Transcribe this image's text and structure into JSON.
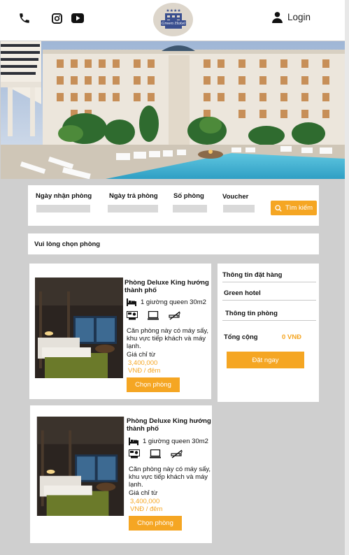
{
  "header": {
    "login_label": "Login",
    "logo_text": "Green Hotel",
    "icons": [
      "phone-icon",
      "instagram-icon",
      "youtube-icon",
      "user-icon"
    ]
  },
  "search": {
    "checkin_label": "Ngày nhận phòng",
    "checkout_label": "Ngày trả phòng",
    "rooms_label": "Số phòng",
    "voucher_label": "Voucher",
    "search_button": "Tìm kiếm"
  },
  "choose_room": "Vui lòng chọn phòng",
  "rooms": [
    {
      "title": "Phòng Deluxe King hướng thành phố",
      "bed": "1 giường queen 30m2",
      "description": "Căn phòng này có máy sấy, khu vực tiếp khách và máy lạnh.",
      "price_label": "Giá chỉ từ",
      "price": "3,400,000",
      "price_unit": "VNĐ / đêm",
      "button": "Chọn phòng"
    },
    {
      "title": "Phòng Deluxe King hướng thành phố",
      "bed": "1 giường queen 30m2",
      "description": "Căn phòng này có máy sấy, khu vực tiếp khách và máy lạnh.",
      "price_label": "Giá chỉ từ",
      "price": "3,400,000",
      "price_unit": "VNĐ / đêm",
      "button": "Chọn phòng"
    }
  ],
  "order": {
    "title": "Thông tin đặt hàng",
    "hotel": "Green hotel",
    "room_info": "Thông tin phòng",
    "total_label": "Tổng cộng",
    "total_value": "0 VNĐ",
    "book_button": "Đặt ngay"
  },
  "colors": {
    "accent": "#f5a623",
    "background": "#cfcfcf",
    "panel": "#ffffff",
    "input": "#d9d9d9"
  }
}
